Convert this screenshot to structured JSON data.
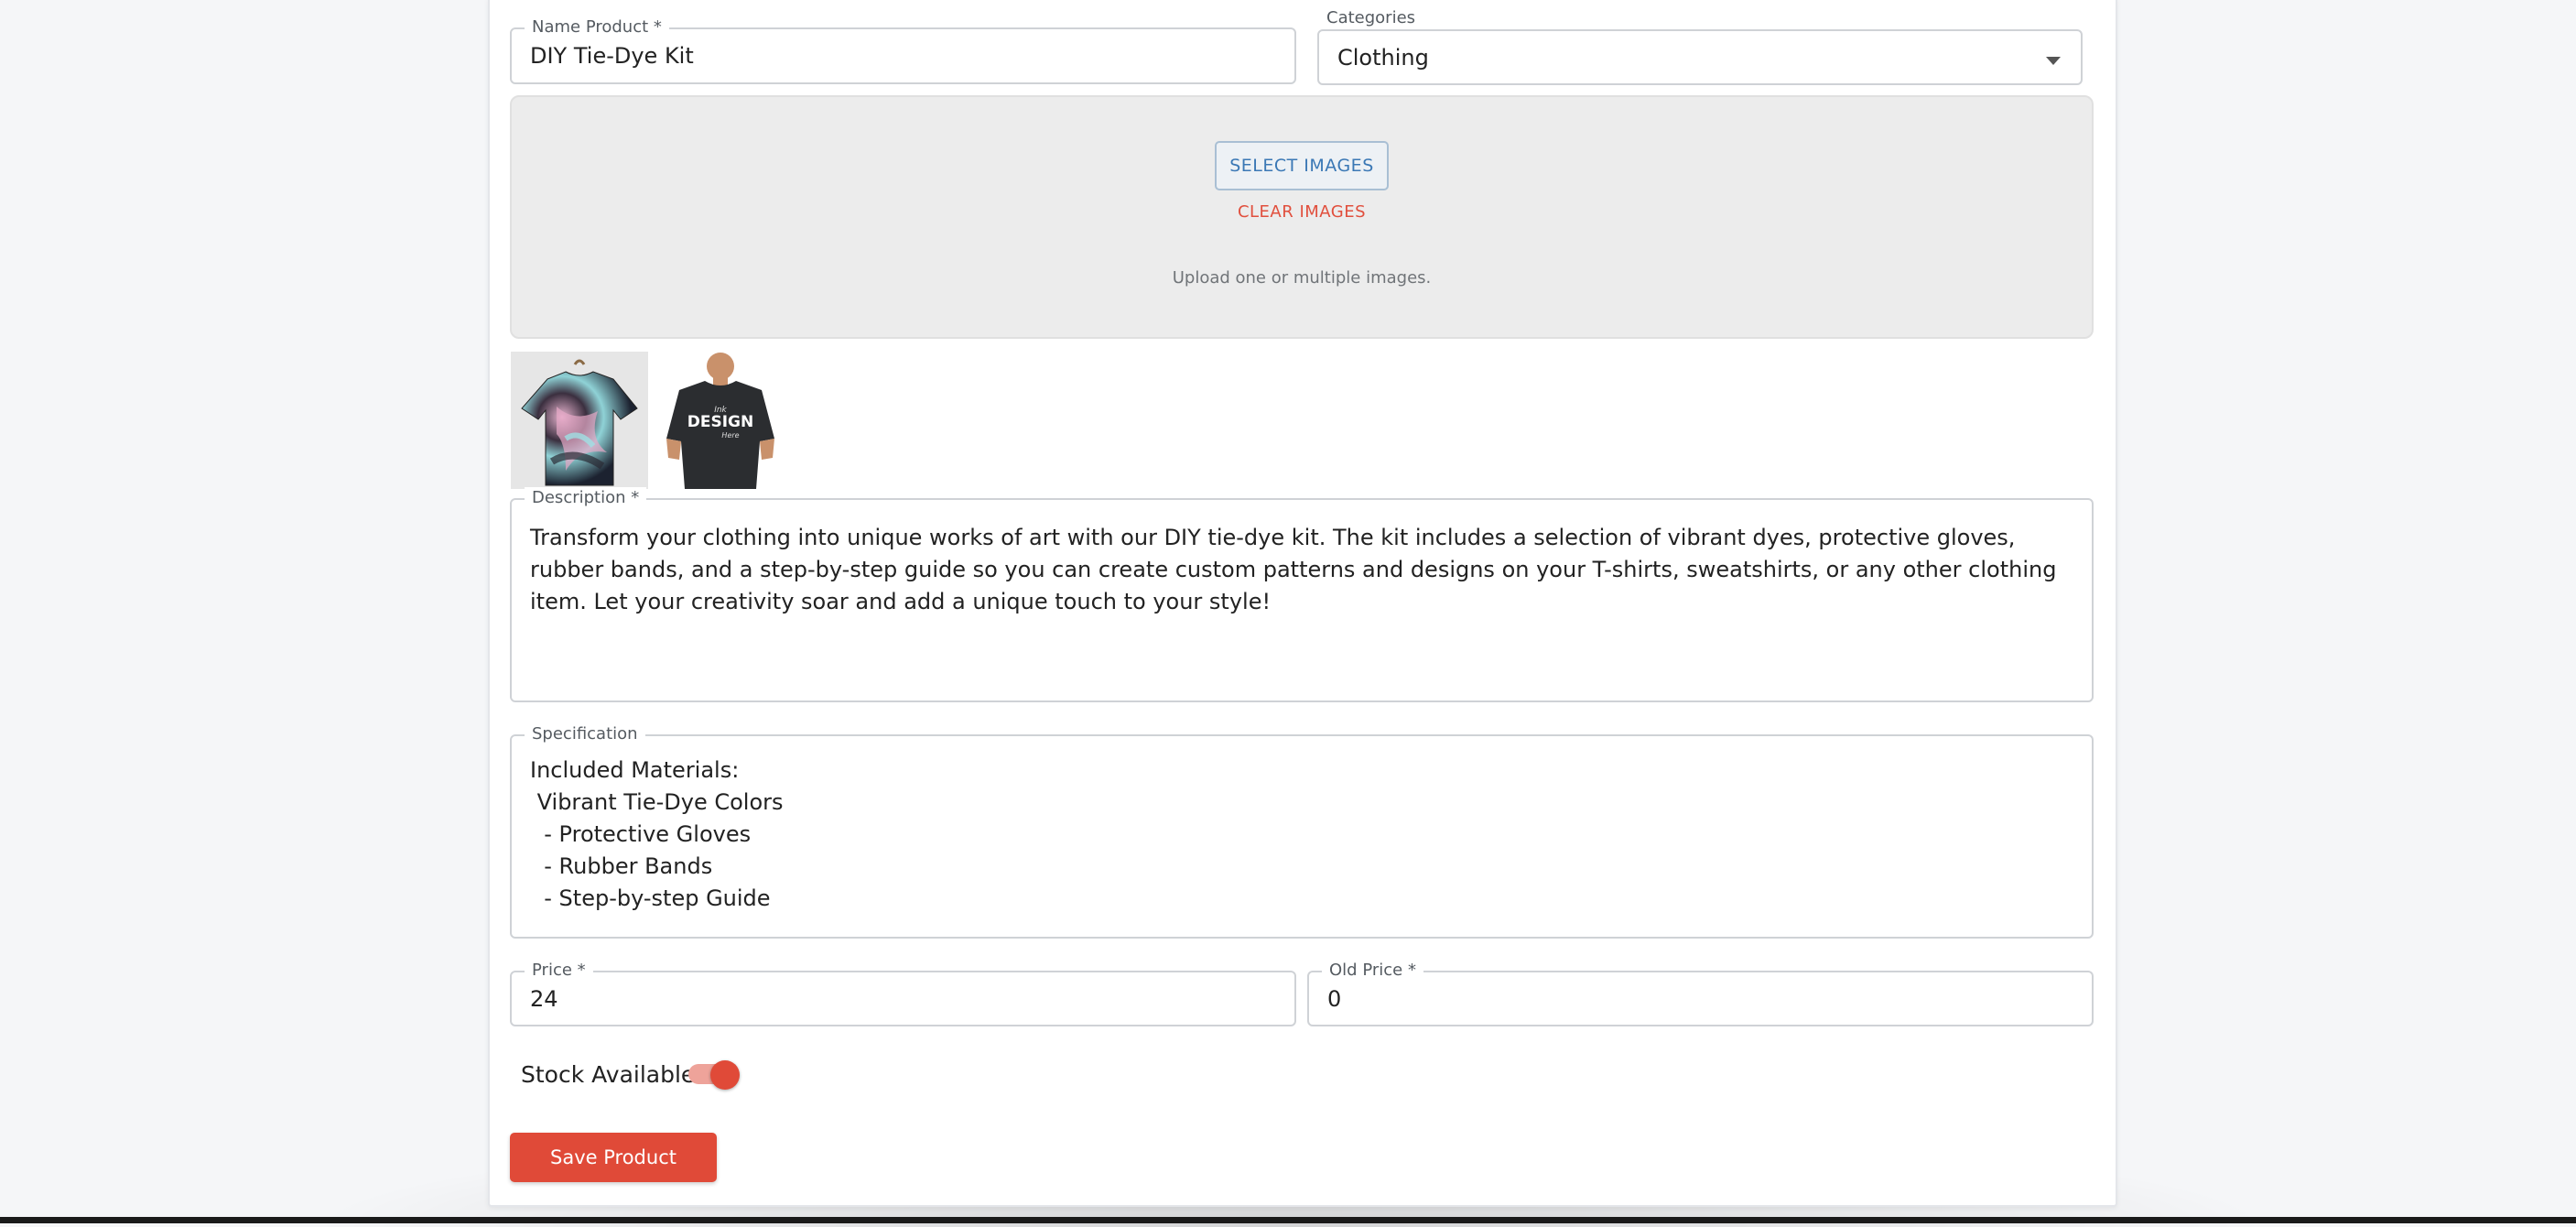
{
  "form": {
    "name_product": {
      "label": "Name Product *",
      "value": "DIY Tie-Dye Kit"
    },
    "categories": {
      "label": "Categories",
      "value": "Clothing"
    },
    "images": {
      "select_label": "SELECT IMAGES",
      "clear_label": "CLEAR IMAGES",
      "hint": "Upload one or multiple images.",
      "thumbnails": [
        {
          "name": "tie-dye-shirt-thumbnail"
        },
        {
          "name": "design-tshirt-thumbnail",
          "shirt_text": "DESIGN"
        }
      ]
    },
    "description": {
      "label": "Description *",
      "value": "Transform your clothing into unique works of art with our DIY tie-dye kit. The kit includes a selection of vibrant dyes, protective gloves, rubber bands, and a step-by-step guide so you can create custom patterns and designs on your T-shirts, sweatshirts, or any other clothing item. Let your creativity soar and add a unique touch to your style!"
    },
    "specification": {
      "label": "Specification",
      "value": "Included Materials:\n Vibrant Tie-Dye Colors\n  - Protective Gloves\n  - Rubber Bands\n  - Step-by-step Guide"
    },
    "price": {
      "label": "Price *",
      "value": "24"
    },
    "old_price": {
      "label": "Old Price *",
      "value": "0"
    },
    "stock": {
      "label": "Stock Available",
      "checked": true
    },
    "save_label": "Save Product"
  },
  "colors": {
    "accent": "#e04a38",
    "link_blue": "#3b78b5"
  }
}
